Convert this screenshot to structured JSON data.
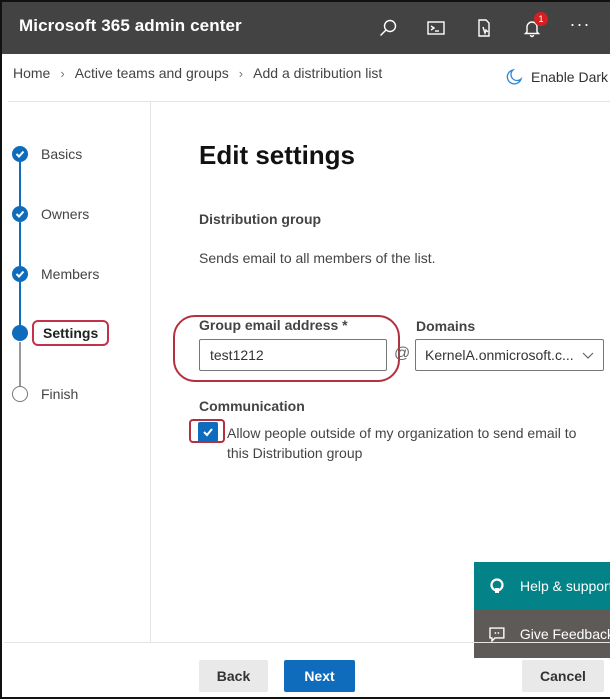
{
  "app": {
    "title": "Microsoft 365 admin center",
    "notification_count": "1",
    "more_label": "···"
  },
  "topbar_icons": [
    "search-icon",
    "terminal-icon",
    "mobile-app-icon",
    "bell-icon",
    "more-icon"
  ],
  "breadcrumb": {
    "items": [
      "Home",
      "Active teams and groups",
      "Add a distribution list"
    ],
    "separator": "›"
  },
  "darkmode": {
    "label": "Enable Dark mode"
  },
  "steps": [
    {
      "label": "Basics",
      "state": "done"
    },
    {
      "label": "Owners",
      "state": "done"
    },
    {
      "label": "Members",
      "state": "done"
    },
    {
      "label": "Settings",
      "state": "current"
    },
    {
      "label": "Finish",
      "state": "todo"
    }
  ],
  "main": {
    "heading": "Edit settings",
    "subheading": "Distribution group",
    "description": "Sends email to all members of the list.",
    "email_label": "Group email address *",
    "email_value": "test1212",
    "at_symbol": "@",
    "domains_label": "Domains",
    "domain_selected": "KernelA.onmicrosoft.c...",
    "communication_label": "Communication",
    "allow_external": {
      "checked": true,
      "label": "Allow people outside of my organization to send email to this Distribution group"
    }
  },
  "floating": {
    "help_label": "Help & support",
    "feedback_label": "Give Feedback"
  },
  "footer": {
    "back_label": "Back",
    "next_label": "Next",
    "cancel_label": "Cancel"
  },
  "colors": {
    "accent": "#0f6cbd",
    "topbar": "#434343",
    "help": "#038387",
    "feedback": "#5d5a58",
    "annotation": "#b3303f"
  }
}
